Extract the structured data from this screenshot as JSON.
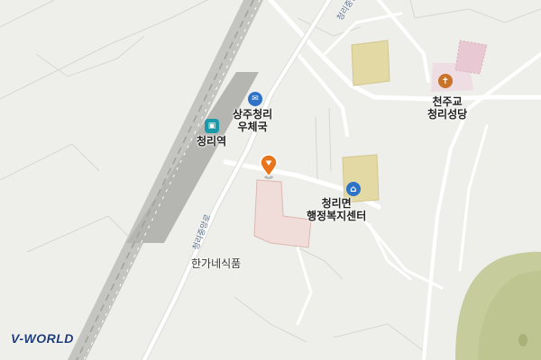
{
  "map": {
    "background": "#eeeeea",
    "road_color": "#ffffff",
    "railway_color": "#b8b8b8",
    "building_color": "#e3d9a4",
    "church_area_color": "#eedde3",
    "landmark_building_color": "#f0dcd8",
    "hill_color": "#c7cc9c"
  },
  "labels": {
    "station": "청리역",
    "post_office_line1": "상주청리",
    "post_office_line2": "우체국",
    "church_line1": "천주교",
    "church_line2": "청리성당",
    "office_line1": "청리면",
    "office_line2": "행정복지센터",
    "food_shop": "한가네식품"
  },
  "road_labels": {
    "top": "청리중앙로",
    "middle": "청리중앙로"
  },
  "icons": {
    "station": {
      "name": "train-station-icon",
      "color": "#1a9aa8"
    },
    "post_office": {
      "name": "post-office-icon",
      "color": "#2f73c8"
    },
    "church": {
      "name": "church-icon",
      "color": "#c8722a"
    },
    "office": {
      "name": "government-office-icon",
      "color": "#2f73c8"
    },
    "marker": {
      "name": "location-marker-icon",
      "color": "#e8741c"
    }
  },
  "logo": {
    "text": "V-WORLD"
  }
}
